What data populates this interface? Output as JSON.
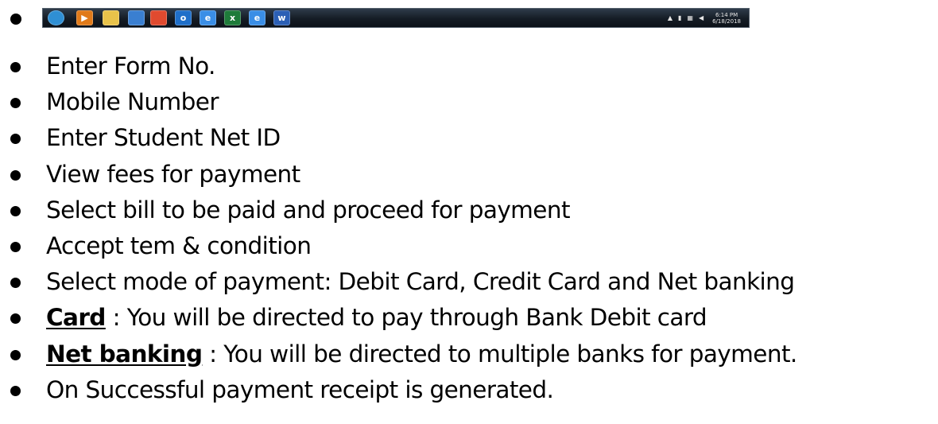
{
  "taskbar": {
    "icons": [
      {
        "name": "start-orb-icon",
        "glyph": "",
        "color": "#2f8fd4"
      },
      {
        "name": "media-player-icon",
        "glyph": "▶",
        "color": "#e07a1a"
      },
      {
        "name": "file-explorer-icon",
        "glyph": "",
        "color": "#e8c24a"
      },
      {
        "name": "network-icon",
        "glyph": "",
        "color": "#3a7fd1"
      },
      {
        "name": "chrome-icon",
        "glyph": "",
        "color": "#e04a2f"
      },
      {
        "name": "outlook-icon",
        "glyph": "o",
        "color": "#1f6fc9"
      },
      {
        "name": "internet-explorer-icon",
        "glyph": "e",
        "color": "#3a8ee6"
      },
      {
        "name": "excel-icon",
        "glyph": "x",
        "color": "#1e7b3a"
      },
      {
        "name": "internet-explorer-icon-2",
        "glyph": "e",
        "color": "#3a8ee6"
      },
      {
        "name": "word-icon",
        "glyph": "w",
        "color": "#2b5fb5"
      }
    ],
    "clock_time": "6:14 PM",
    "clock_date": "6/18/2018"
  },
  "items": [
    {
      "bold": "",
      "text": "Enter Form No."
    },
    {
      "bold": "",
      "text": "Mobile Number"
    },
    {
      "bold": "",
      "text": "Enter Student Net ID"
    },
    {
      "bold": "",
      "text": "View fees for payment"
    },
    {
      "bold": "",
      "text": "Select bill to be paid and proceed for payment"
    },
    {
      "bold": "",
      "text": "Accept tem & condition"
    },
    {
      "bold": "",
      "text": "Select mode of payment: Debit Card, Credit Card and Net banking"
    },
    {
      "bold": "Card",
      "text": " : You will be directed to pay through Bank Debit card"
    },
    {
      "bold": "Net banking",
      "text": " : You will be directed to multiple banks for payment."
    },
    {
      "bold": "",
      "text": "On Successful payment receipt is generated."
    }
  ]
}
